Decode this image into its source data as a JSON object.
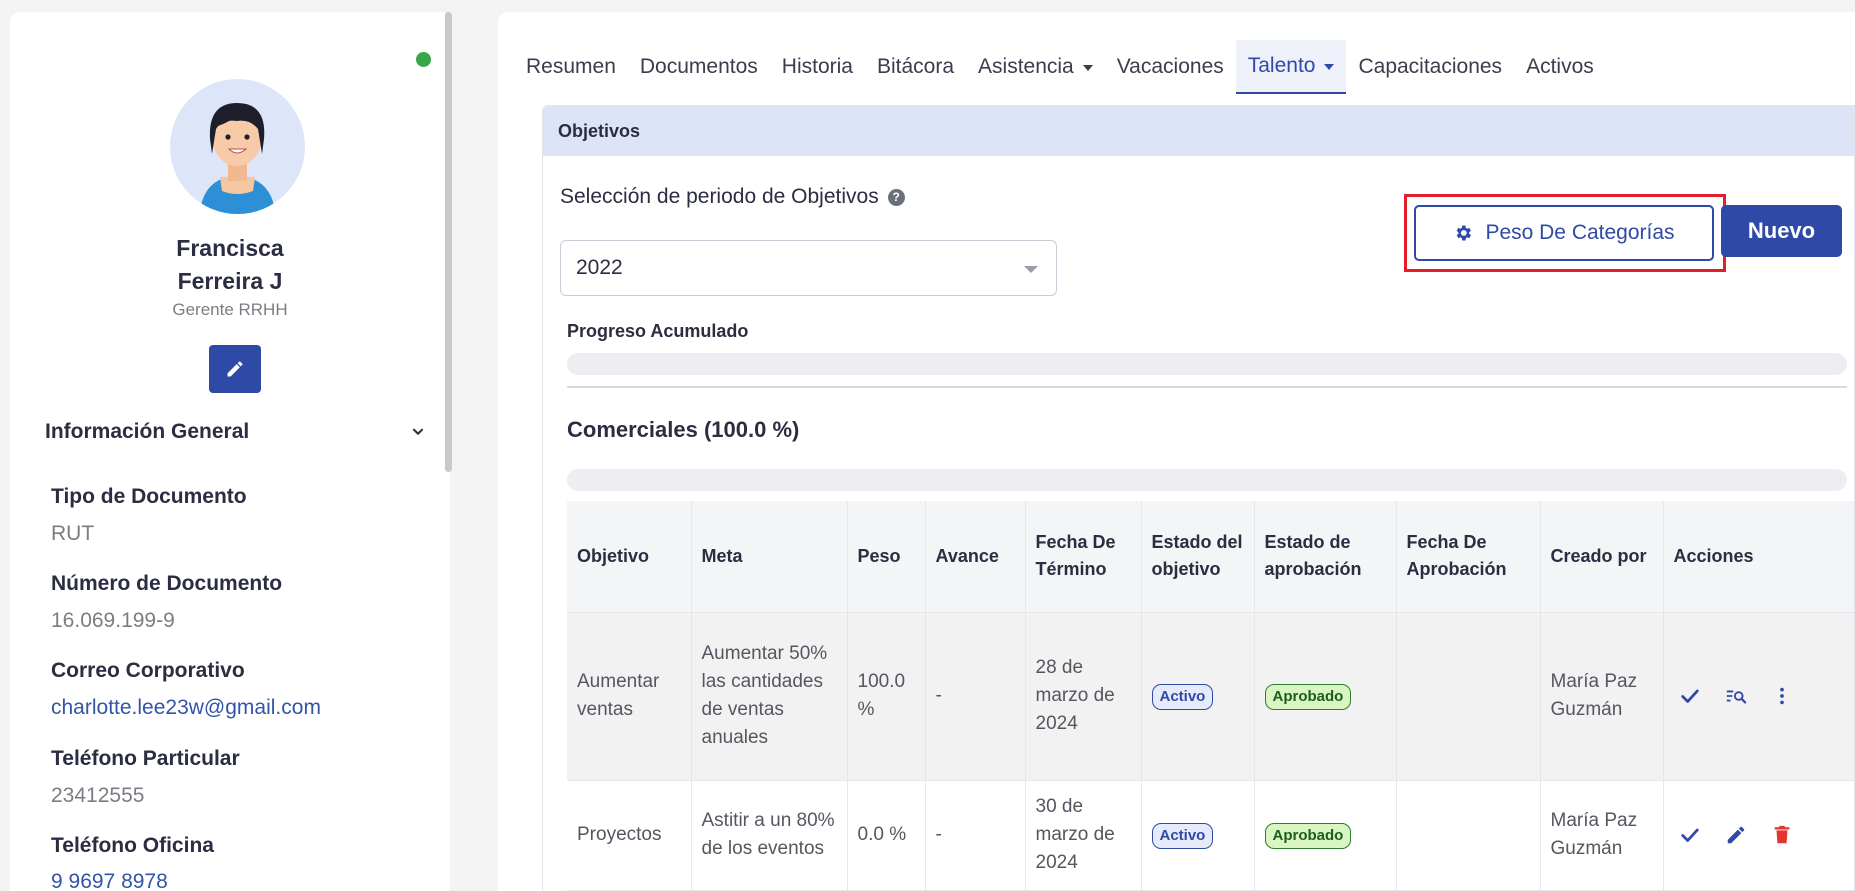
{
  "profile": {
    "name_line1": "Francisca",
    "name_line2": "Ferreira J",
    "role": "Gerente RRHH",
    "status_color": "#3aa64a"
  },
  "general_info": {
    "title": "Información General",
    "fields": [
      {
        "label": "Tipo de Documento",
        "value": "RUT"
      },
      {
        "label": "Número de Documento",
        "value": "16.069.199-9"
      },
      {
        "label": "Correo Corporativo",
        "value": "charlotte.lee23w@gmail.com"
      },
      {
        "label": "Teléfono Particular",
        "value": "23412555"
      },
      {
        "label": "Teléfono Oficina",
        "value": "9 9697 8978"
      }
    ]
  },
  "tabs": [
    "Resumen",
    "Documentos",
    "Historia",
    "Bitácora",
    "Asistencia",
    "Vacaciones",
    "Talento",
    "Capacitaciones",
    "Activos"
  ],
  "active_tab": "Talento",
  "objectives": {
    "card_title": "Objetivos",
    "period_label": "Selección de periodo de Objetivos",
    "period_value": "2022",
    "peso_button": "Peso De Categorías",
    "nuevo_button": "Nuevo",
    "progress_label": "Progreso Acumulado",
    "progress_value": 0,
    "category_title": "Comerciales (100.0 %)",
    "category_progress": 0
  },
  "table": {
    "headers": [
      "Objetivo",
      "Meta",
      "Peso",
      "Avance",
      "Fecha De Término",
      "Estado del objetivo",
      "Estado de aprobación",
      "Fecha De Aprobación",
      "Creado por",
      "Acciones"
    ],
    "rows": [
      {
        "objetivo": "Aumentar ventas",
        "meta": "Aumentar 50% las cantidades de ventas anuales",
        "peso": "100.0 %",
        "avance": "-",
        "fecha_termino": "28 de marzo de 2024",
        "estado": "Activo",
        "aprobacion": "Aprobado",
        "fecha_aprobacion": "",
        "creado_por": "María Paz Guzmán"
      },
      {
        "objetivo": "Proyectos",
        "meta": "Astitir a un 80% de los eventos",
        "peso": "0.0 %",
        "avance": "-",
        "fecha_termino": "30 de marzo de 2024",
        "estado": "Activo",
        "aprobacion": "Aprobado",
        "fecha_aprobacion": "",
        "creado_por": "María Paz Guzmán"
      }
    ]
  },
  "colors": {
    "primary": "#2f4aa6",
    "highlight": "#e3202a",
    "delete": "#e3342f"
  }
}
